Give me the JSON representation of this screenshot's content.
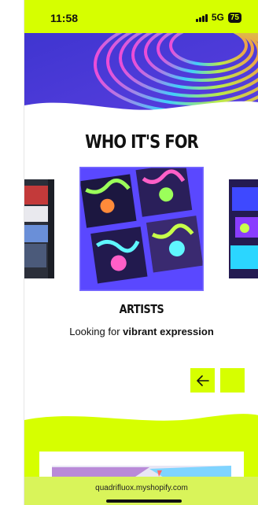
{
  "status_bar": {
    "time": "11:58",
    "network": "5G",
    "battery": "75"
  },
  "section": {
    "title": "WHO IT'S FOR"
  },
  "carousel": {
    "active_card": {
      "heading": "ARTISTS",
      "desc_prefix": "Looking for ",
      "desc_bold": "vibrant expression"
    },
    "prev_icon": "arrow-left-icon",
    "next_icon": ""
  },
  "browser": {
    "url": "quadrifluox.myshopify.com"
  },
  "colors": {
    "accent": "#d6ff00",
    "text": "#111111",
    "hero_purple": "#4a3bd6"
  }
}
